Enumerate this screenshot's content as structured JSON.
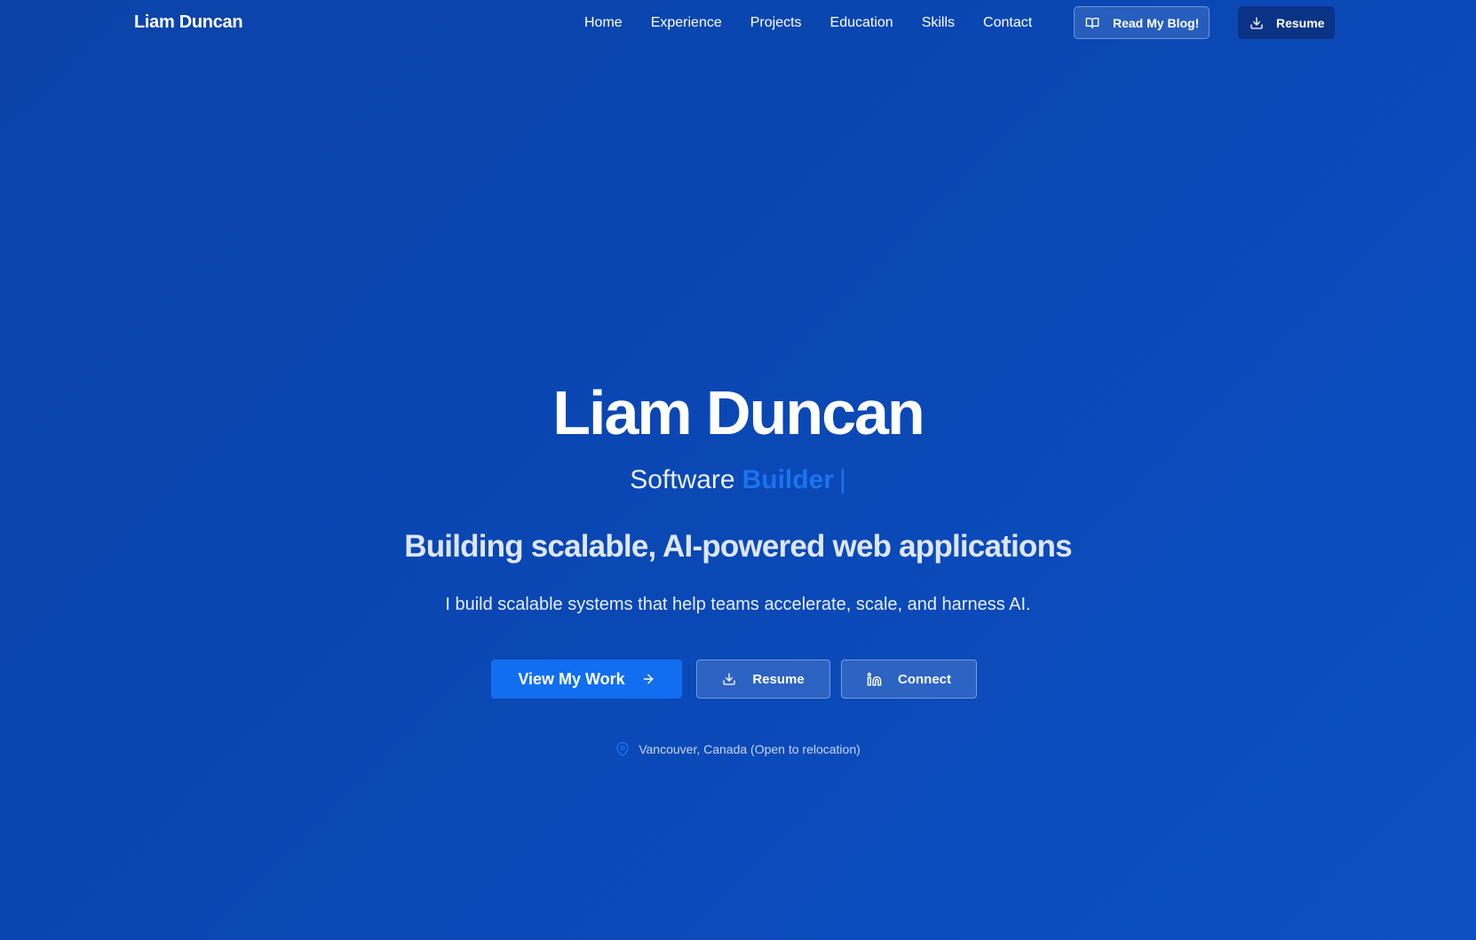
{
  "nav": {
    "brand": "Liam Duncan",
    "links": [
      "Home",
      "Experience",
      "Projects",
      "Education",
      "Skills",
      "Contact"
    ],
    "blog_button": "Read My Blog!",
    "resume_button": "Resume"
  },
  "hero": {
    "name": "Liam Duncan",
    "role_static": "Software",
    "role_dynamic": "Builder",
    "cursor": "|",
    "tagline": "Building scalable, AI-powered web applications",
    "description": "I build scalable systems that help teams accelerate, scale, and harness AI.",
    "cta_primary": "View My Work",
    "cta_resume": "Resume",
    "cta_connect": "Connect",
    "location": "Vancouver, Canada (Open to relocation)"
  },
  "colors": {
    "background": "#0b47b3",
    "accent": "#116ef0",
    "nav_resume_bg": "#0a3386"
  },
  "icons": {
    "blog": "book-open-icon",
    "download": "download-icon",
    "arrow": "arrow-right-icon",
    "linkedin": "linkedin-icon",
    "location": "map-pin-icon"
  }
}
